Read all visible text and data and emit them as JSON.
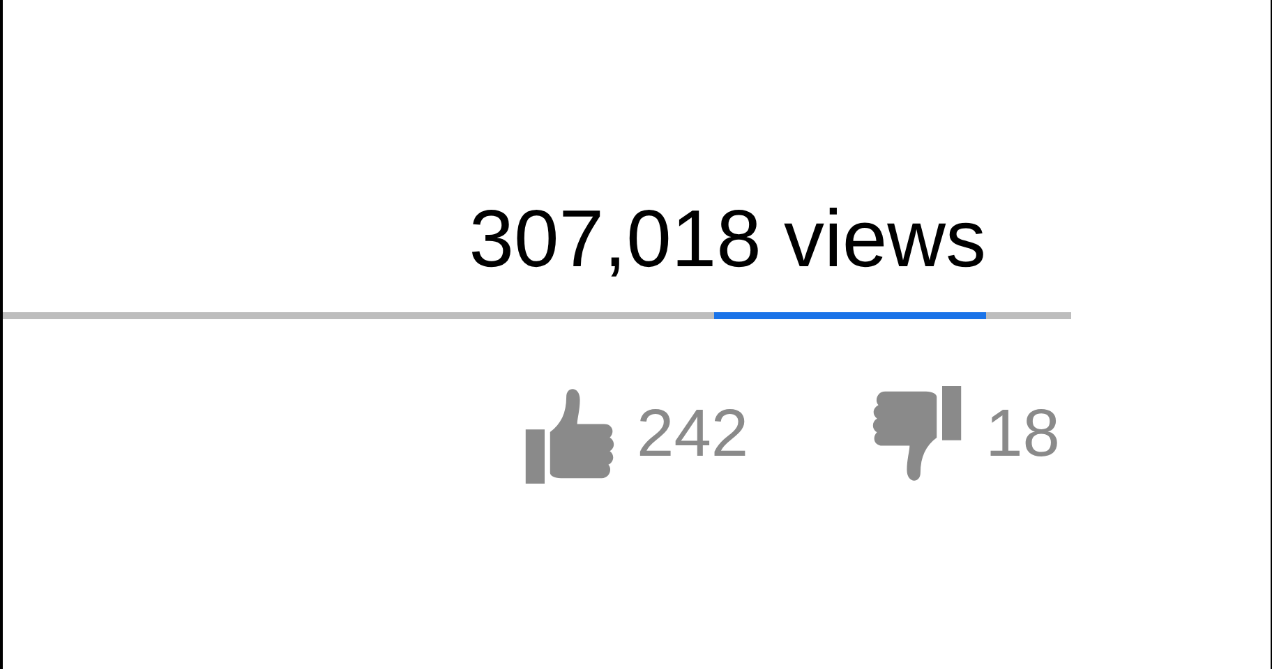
{
  "views": {
    "count": "307,018 views"
  },
  "rating_bar": {
    "level": 0.76
  },
  "likes": {
    "count": "242"
  },
  "dislikes": {
    "count": "18"
  }
}
